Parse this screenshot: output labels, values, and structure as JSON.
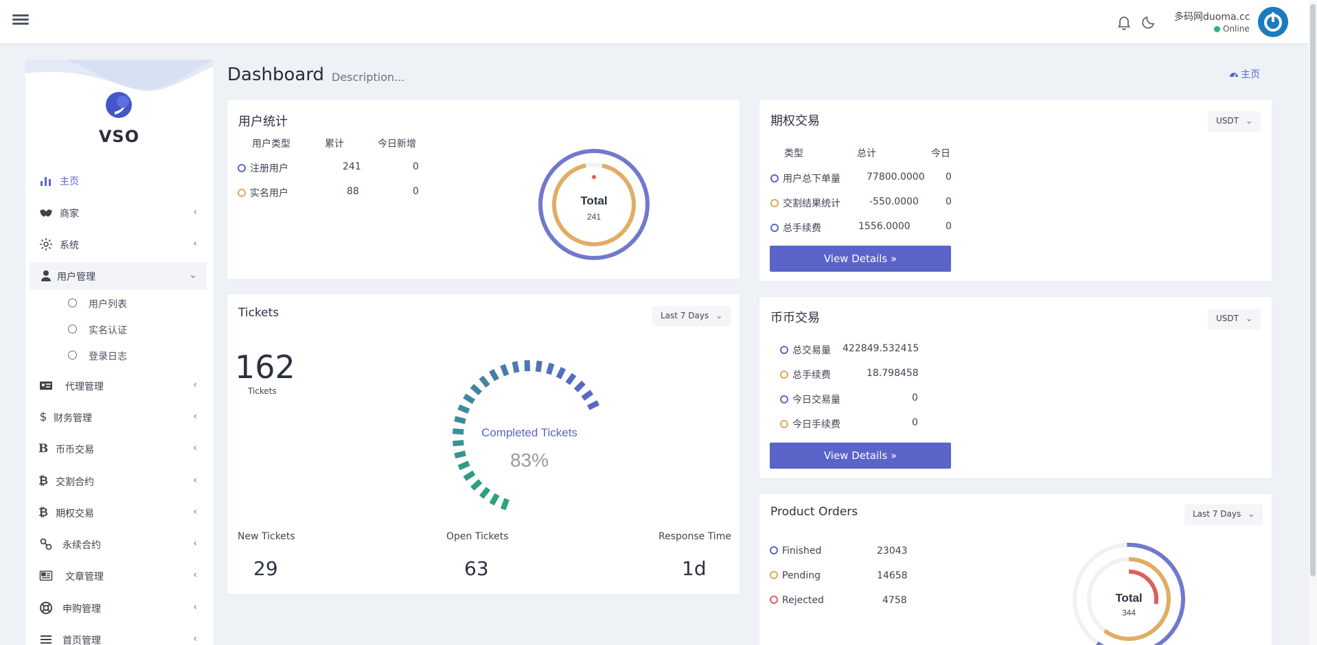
{
  "topbar": {
    "user_name": "多码网duoma.cc",
    "user_status": "Online"
  },
  "sidebar": {
    "brand": "VSO",
    "items": [
      {
        "label": "主页",
        "icon": "bar-chart-icon"
      },
      {
        "label": "商家",
        "icon": "handshake-icon"
      },
      {
        "label": "系统",
        "icon": "gear-icon"
      },
      {
        "label": "用户管理",
        "icon": "users-icon"
      },
      {
        "label": "代理管理",
        "icon": "id-card-icon"
      },
      {
        "label": "财务管理",
        "icon": "dollar-icon"
      },
      {
        "label": "币币交易",
        "icon": "bold-b-icon"
      },
      {
        "label": "交割合约",
        "icon": "bitcoin-icon"
      },
      {
        "label": "期权交易",
        "icon": "bitcoin-icon"
      },
      {
        "label": "永续合约",
        "icon": "link-icon"
      },
      {
        "label": "文章管理",
        "icon": "newspaper-icon"
      },
      {
        "label": "申购管理",
        "icon": "life-ring-icon"
      },
      {
        "label": "首页管理",
        "icon": "list-icon"
      }
    ],
    "subitems": [
      "用户列表",
      "实名认证",
      "登录日志"
    ],
    "glyphs": {
      "dollar": "$",
      "bold_b": "B",
      "bitcoin": "₿",
      "chev_left": "‹",
      "chev_down": "⌄"
    }
  },
  "header": {
    "title": "Dashboard",
    "description": "Description...",
    "breadcrumb": "主页"
  },
  "user_stats": {
    "title": "用户统计",
    "columns": [
      "用户类型",
      "累计",
      "今日新增"
    ],
    "rows": [
      {
        "type": "注册用户",
        "total": "241",
        "today": "0"
      },
      {
        "type": "实名用户",
        "total": "88",
        "today": "0"
      }
    ],
    "donut_label": "Total",
    "donut_value": "241"
  },
  "options": {
    "title": "期权交易",
    "currency": "USDT",
    "columns": [
      "类型",
      "总计",
      "今日"
    ],
    "rows": [
      {
        "type": "用户总下单量",
        "total": "77800.0000",
        "today": "0"
      },
      {
        "type": "交割结果统计",
        "total": "-550.0000",
        "today": "0"
      },
      {
        "type": "总手续费",
        "total": "1556.0000",
        "today": "0"
      }
    ],
    "button": "View Details »"
  },
  "tickets": {
    "title": "Tickets",
    "range": "Last 7 Days",
    "count": "162",
    "count_label": "Tickets",
    "gauge_label": "Completed Tickets",
    "gauge_value": "83%",
    "gauge_percent": 83,
    "stats": [
      {
        "label": "New Tickets",
        "value": "29"
      },
      {
        "label": "Open Tickets",
        "value": "63"
      },
      {
        "label": "Response Time",
        "value": "1d"
      }
    ]
  },
  "spot": {
    "title": "币币交易",
    "currency": "USDT",
    "rows": [
      {
        "label": "总交易量",
        "value": "422849.532415"
      },
      {
        "label": "总手续费",
        "value": "18.798458"
      },
      {
        "label": "今日交易量",
        "value": "0"
      },
      {
        "label": "今日手续费",
        "value": "0"
      }
    ],
    "button": "View Details »"
  },
  "orders": {
    "title": "Product Orders",
    "range": "Last 7 Days",
    "rows": [
      {
        "label": "Finished",
        "value": "23043"
      },
      {
        "label": "Pending",
        "value": "14658"
      },
      {
        "label": "Rejected",
        "value": "4758"
      }
    ],
    "donut_label": "Total",
    "donut_value": "344"
  },
  "colors": {
    "accent": "#5b64c9",
    "orange": "#e0a85d",
    "red": "#e05d5d",
    "green": "#2aa57a"
  }
}
